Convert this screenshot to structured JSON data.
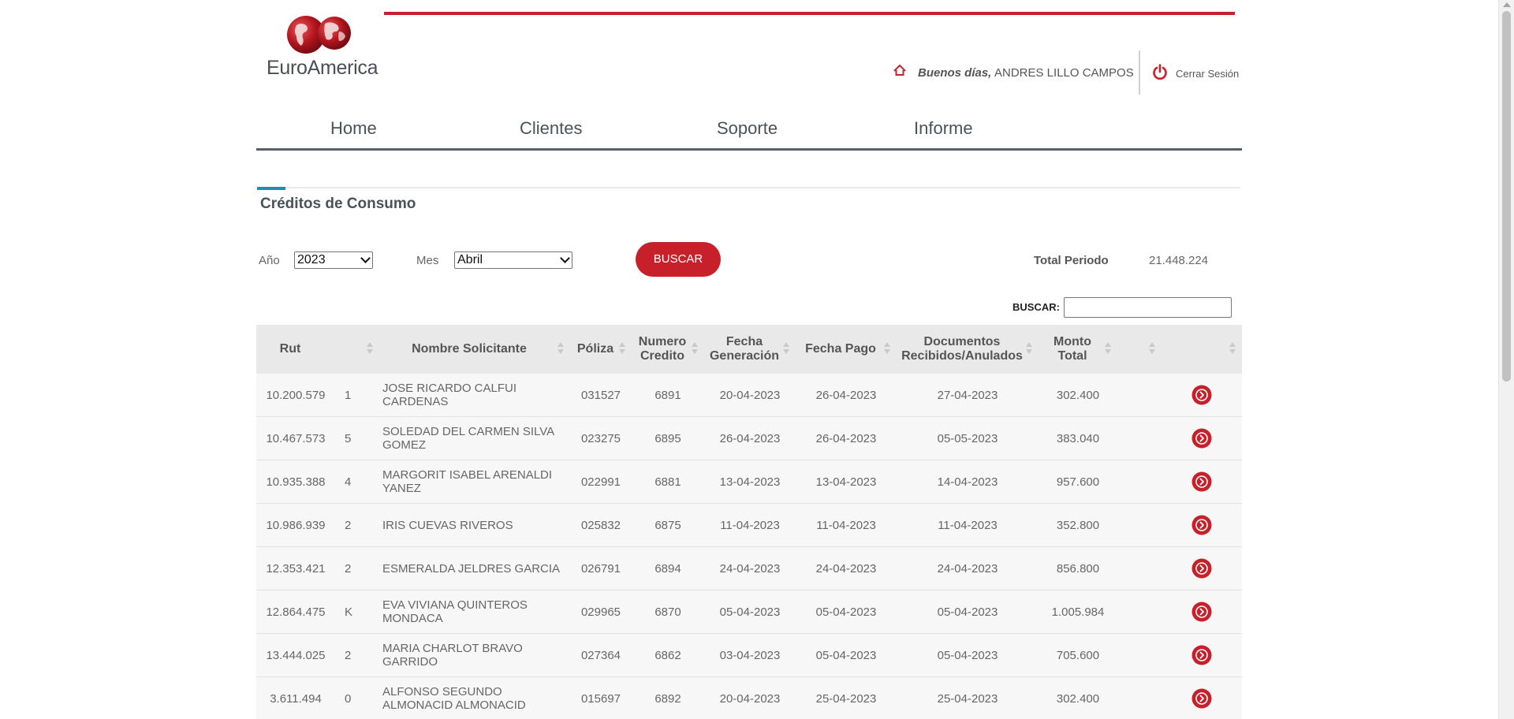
{
  "brand": {
    "name": "EuroAmerica"
  },
  "colors": {
    "accent_red": "#c8202a",
    "accent_blue": "#1a8fb0"
  },
  "header": {
    "greeting": "Buenos días,",
    "user_name": "ANDRES LILLO CAMPOS",
    "logout_label": "Cerrar Sesión"
  },
  "nav": {
    "items": [
      "Home",
      "Clientes",
      "Soporte",
      "Informe"
    ]
  },
  "section": {
    "title": "Créditos de Consumo"
  },
  "filters": {
    "year_label": "Año",
    "year_value": "2023",
    "month_label": "Mes",
    "month_value": "Abril",
    "search_button": "BUSCAR",
    "total_label": "Total Periodo",
    "total_value": "21.448.224"
  },
  "search": {
    "label": "BUSCAR:",
    "value": ""
  },
  "table": {
    "headers": [
      "Rut",
      "",
      "Nombre Solicitante",
      "Póliza",
      "Numero Credito",
      "Fecha Generación",
      "Fecha Pago",
      "Documentos Recibidos/Anulados",
      "Monto Total",
      "",
      ""
    ],
    "rows": [
      {
        "rut": "10.200.579",
        "dv": "1",
        "name": "JOSE RICARDO CALFUI CARDENAS",
        "poliza": "031527",
        "credito": "6891",
        "fecha_gen": "20-04-2023",
        "fecha_pago": "26-04-2023",
        "documentos": "27-04-2023",
        "monto": "302.400"
      },
      {
        "rut": "10.467.573",
        "dv": "5",
        "name": "SOLEDAD DEL CARMEN SILVA GOMEZ",
        "poliza": "023275",
        "credito": "6895",
        "fecha_gen": "26-04-2023",
        "fecha_pago": "26-04-2023",
        "documentos": "05-05-2023",
        "monto": "383.040"
      },
      {
        "rut": "10.935.388",
        "dv": "4",
        "name": "MARGORIT ISABEL ARENALDI YANEZ",
        "poliza": "022991",
        "credito": "6881",
        "fecha_gen": "13-04-2023",
        "fecha_pago": "13-04-2023",
        "documentos": "14-04-2023",
        "monto": "957.600"
      },
      {
        "rut": "10.986.939",
        "dv": "2",
        "name": "IRIS CUEVAS RIVEROS",
        "poliza": "025832",
        "credito": "6875",
        "fecha_gen": "11-04-2023",
        "fecha_pago": "11-04-2023",
        "documentos": "11-04-2023",
        "monto": "352.800"
      },
      {
        "rut": "12.353.421",
        "dv": "2",
        "name": "ESMERALDA JELDRES GARCIA",
        "poliza": "026791",
        "credito": "6894",
        "fecha_gen": "24-04-2023",
        "fecha_pago": "24-04-2023",
        "documentos": "24-04-2023",
        "monto": "856.800"
      },
      {
        "rut": "12.864.475",
        "dv": "K",
        "name": "EVA VIVIANA QUINTEROS MONDACA",
        "poliza": "029965",
        "credito": "6870",
        "fecha_gen": "05-04-2023",
        "fecha_pago": "05-04-2023",
        "documentos": "05-04-2023",
        "monto": "1.005.984"
      },
      {
        "rut": "13.444.025",
        "dv": "2",
        "name": "MARIA CHARLOT BRAVO GARRIDO",
        "poliza": "027364",
        "credito": "6862",
        "fecha_gen": "03-04-2023",
        "fecha_pago": "05-04-2023",
        "documentos": "05-04-2023",
        "monto": "705.600"
      },
      {
        "rut": "3.611.494",
        "dv": "0",
        "name": "ALFONSO SEGUNDO ALMONACID ALMONACID",
        "poliza": "015697",
        "credito": "6892",
        "fecha_gen": "20-04-2023",
        "fecha_pago": "25-04-2023",
        "documentos": "25-04-2023",
        "monto": "302.400"
      }
    ],
    "row_action_icon": "chevron-right-circle-icon"
  }
}
